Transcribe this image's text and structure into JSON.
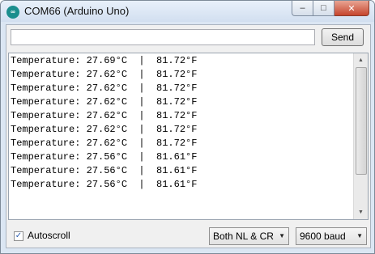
{
  "window": {
    "title": "COM66 (Arduino Uno)",
    "icon": "arduino-icon",
    "icon_glyph": "∞",
    "controls": {
      "minimize": "–",
      "maximize": "□",
      "close": "✕"
    }
  },
  "input": {
    "value": "",
    "placeholder": ""
  },
  "send": {
    "label": "Send"
  },
  "output": {
    "lines": [
      "Temperature: 27.69°C  |  81.72°F",
      "Temperature: 27.62°C  |  81.72°F",
      "Temperature: 27.62°C  |  81.72°F",
      "Temperature: 27.62°C  |  81.72°F",
      "Temperature: 27.62°C  |  81.72°F",
      "Temperature: 27.62°C  |  81.72°F",
      "Temperature: 27.62°C  |  81.72°F",
      "Temperature: 27.56°C  |  81.61°F",
      "Temperature: 27.56°C  |  81.61°F",
      "Temperature: 27.56°C  |  81.61°F"
    ]
  },
  "scrollbar": {
    "up": "▲",
    "down": "▼"
  },
  "footer": {
    "autoscroll": {
      "label": "Autoscroll",
      "checked": true,
      "mark": "✓"
    },
    "line_ending": {
      "selected": "Both NL & CR"
    },
    "baud": {
      "selected": "9600 baud"
    },
    "caret": "▼"
  }
}
